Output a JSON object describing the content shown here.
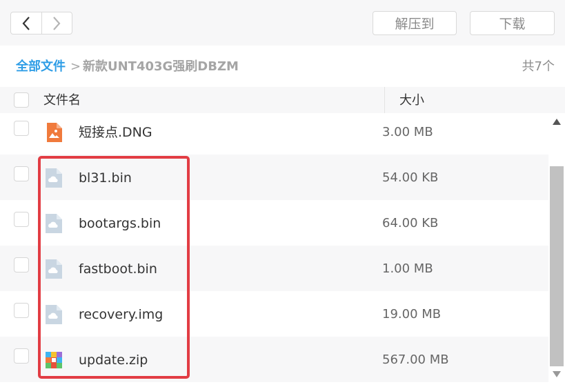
{
  "toolbar": {
    "back_icon": "chevron-left-icon",
    "forward_icon": "chevron-right-icon",
    "extract_label": "解压到",
    "download_label": "下载"
  },
  "breadcrumb": {
    "root": "全部文件",
    "separator": ">",
    "current": "新款UNT403G强刷DBZM",
    "count": "共7个"
  },
  "table": {
    "headers": {
      "name": "文件名",
      "size": "大小"
    },
    "rows": [
      {
        "name": "短接点.DNG",
        "size": "3.00 MB",
        "icon": "image-file-icon"
      },
      {
        "name": "bl31.bin",
        "size": "54.00 KB",
        "icon": "cloud-file-icon"
      },
      {
        "name": "bootargs.bin",
        "size": "64.00 KB",
        "icon": "cloud-file-icon"
      },
      {
        "name": "fastboot.bin",
        "size": "1.00 MB",
        "icon": "cloud-file-icon"
      },
      {
        "name": "recovery.img",
        "size": "19.00 MB",
        "icon": "cloud-file-icon"
      },
      {
        "name": "update.zip",
        "size": "567.00 MB",
        "icon": "zip-file-icon"
      }
    ]
  },
  "colors": {
    "accent": "#2e9de6",
    "highlight": "#e23d44",
    "image_icon": "#f07a3c",
    "cloud_icon": "#c9d6e2"
  }
}
